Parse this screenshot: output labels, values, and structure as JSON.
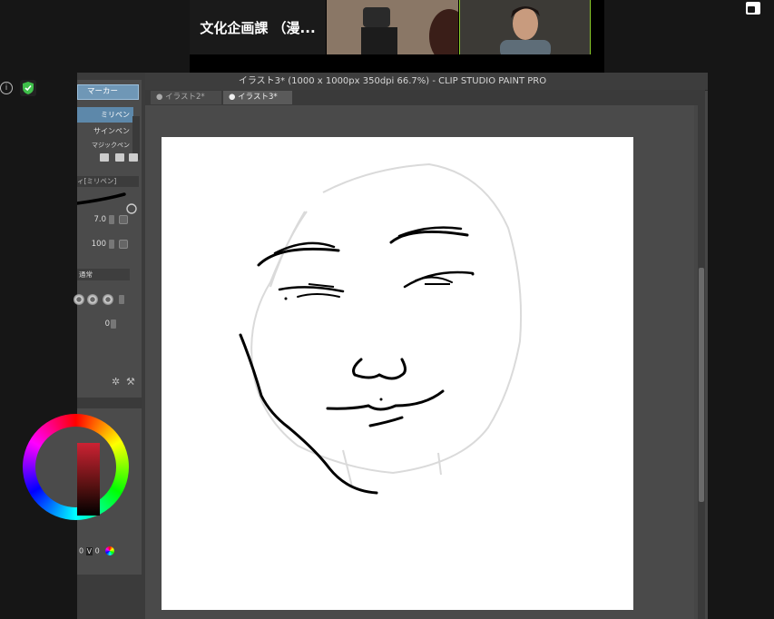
{
  "zoom": {
    "meeting_name": "文化企画課 （漫...",
    "icons": [
      "info-icon",
      "shield-check-icon",
      "layout-toggle-icon"
    ]
  },
  "app": {
    "title": "イラスト3* (1000 x 1000px 350dpi 66.7%)  - CLIP STUDIO PAINT PRO",
    "tabs": [
      "イラスト2*",
      "イラスト3*"
    ],
    "active_tab": 1
  },
  "palette": {
    "sub_tool_group": "マーカー",
    "brushes": [
      "ミリペン",
      "サインペン",
      "マジックペン"
    ],
    "selected_brush": 0,
    "tool_property_title": "ィ[ミリペン]",
    "brush_size": "7.0",
    "opacity": "100",
    "blend_mode": "通常",
    "anti_alias_value": "0"
  },
  "color": {
    "readout_left": "0",
    "readout_v": "V",
    "readout_right": "0",
    "accent": "#6f97b6",
    "active_hue": "#c22233"
  }
}
